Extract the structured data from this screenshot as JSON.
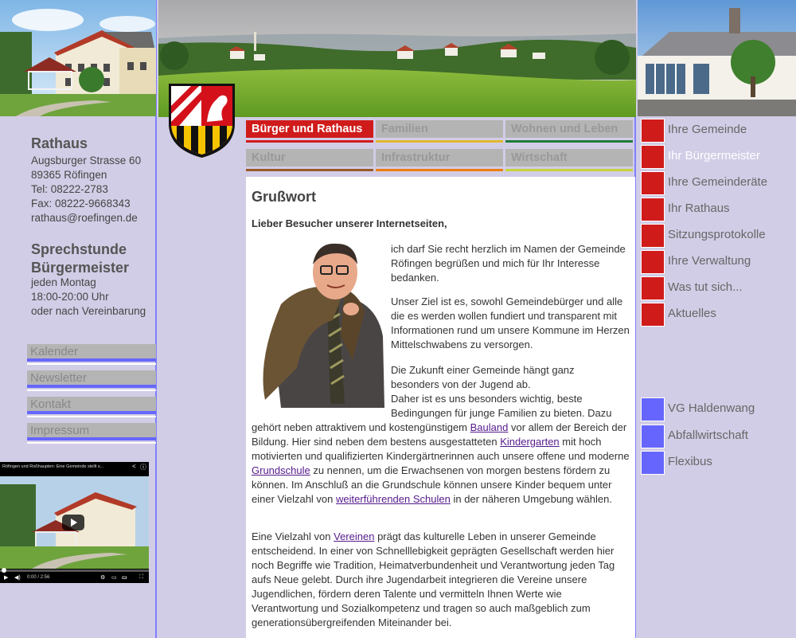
{
  "colors": {
    "accent_red": "#d01b1b",
    "accent_blue": "#6666ff",
    "bg_lavender": "#d2cde6",
    "tab_grey": "#b4b4b4"
  },
  "left": {
    "rathaus_title": "Rathaus",
    "address": [
      "Augsburger Strasse 60",
      "89365 Röfingen",
      "Tel: 08222-2783",
      "Fax: 08222-9668343",
      "rathaus@roefingen.de"
    ],
    "sprechstunde_title": [
      "Sprechstunde",
      "Bürgermeister"
    ],
    "sprechstunde_lines": [
      "jeden Montag",
      "18:00-20:00 Uhr",
      "oder nach Vereinbarung"
    ],
    "links": [
      "Kalender",
      "Newsletter",
      "Kontakt",
      "Impressum"
    ],
    "video": {
      "title": "Röfingen und Roßhaupten: Eine Gemeinde stellt s...",
      "time": "0:00 / 2:56"
    }
  },
  "nav": {
    "row1": [
      {
        "label": "Bürger und Rathaus",
        "color": "#d01b1b",
        "active": true
      },
      {
        "label": "Familien",
        "color": "#e0b830"
      },
      {
        "label": "Wohnen und Leben",
        "color": "#1f7a3a"
      }
    ],
    "row2": [
      {
        "label": "Kultur",
        "color": "#9a5a2a"
      },
      {
        "label": "Infrastruktur",
        "color": "#ef7d12"
      },
      {
        "label": "Wirtschaft",
        "color": "#c7d43a"
      }
    ]
  },
  "content": {
    "heading": "Grußwort",
    "greeting": "Lieber Besucher unserer Internetseiten,",
    "p1": "ich darf Sie recht herzlich im Namen der Gemeinde Röfingen begrüßen und mich für Ihr Interesse bedanken.",
    "p2": "Unser Ziel ist es, sowohl Gemeindebürger und alle die es werden wollen fundiert und transparent mit Informationen rund um unsere Kommune im Herzen Mittelschwabens zu versorgen.",
    "p3a": "Die Zukunft einer Gemeinde hängt ganz besonders von der Jugend ab.",
    "p3b": "Daher ist es uns besonders wichtig, beste Bedingungen für junge Familien zu bieten. Dazu gehört neben attraktivem und kostengünstigem",
    "link_bauland": "Bauland",
    "p3c": "vor allem der Bereich der Bildung. Hier sind neben dem bestens ausgestatteten",
    "link_kindergarten": "Kindergarten",
    "p3d": "mit hoch motivierten und qualifizierten Kindergärtnerinnen auch unsere offene und moderne",
    "link_grundschule": "Grundschule",
    "p3e": "zu nennen, um die Erwachsenen von morgen bestens fördern zu können. Im Anschluß an die Grundschule können unsere Kinder bequem unter einer Vielzahl von",
    "link_schulen": "weiterführenden Schulen",
    "p3f": "in der näheren Umgebung wählen.",
    "p4a": "Eine Vielzahl von",
    "link_vereine": "Vereinen",
    "p4b": "prägt das kulturelle Leben in unserer Gemeinde entscheidend. In einer von Schnelllebigkeit geprägten Gesellschaft werden hier noch Begriffe wie Tradition, Heimatverbundenheit und Verantwortung jeden Tag aufs Neue gelebt. Durch ihre Jugendarbeit integrieren die Vereine unsere Jugendlichen, fördern deren Talente und vermitteln Ihnen Werte wie Verantwortung und Sozialkompetenz und tragen so auch maßgeblich zum generationsübergreifenden Miteinander bei."
  },
  "right": {
    "nav": [
      {
        "label": "Ihre Gemeinde",
        "active": false
      },
      {
        "label": "Ihr Bürgermeister",
        "active": true
      },
      {
        "label": "Ihre Gemeinderäte",
        "active": false
      },
      {
        "label": "Ihr Rathaus",
        "active": false
      },
      {
        "label": "Sitzungsprotokolle",
        "active": false
      },
      {
        "label": "Ihre Verwaltung",
        "active": false
      },
      {
        "label": "Was tut sich...",
        "active": false
      },
      {
        "label": "Aktuelles",
        "active": false
      }
    ],
    "links": [
      "VG Haldenwang",
      "Abfallwirtschaft",
      "Flexibus"
    ]
  }
}
